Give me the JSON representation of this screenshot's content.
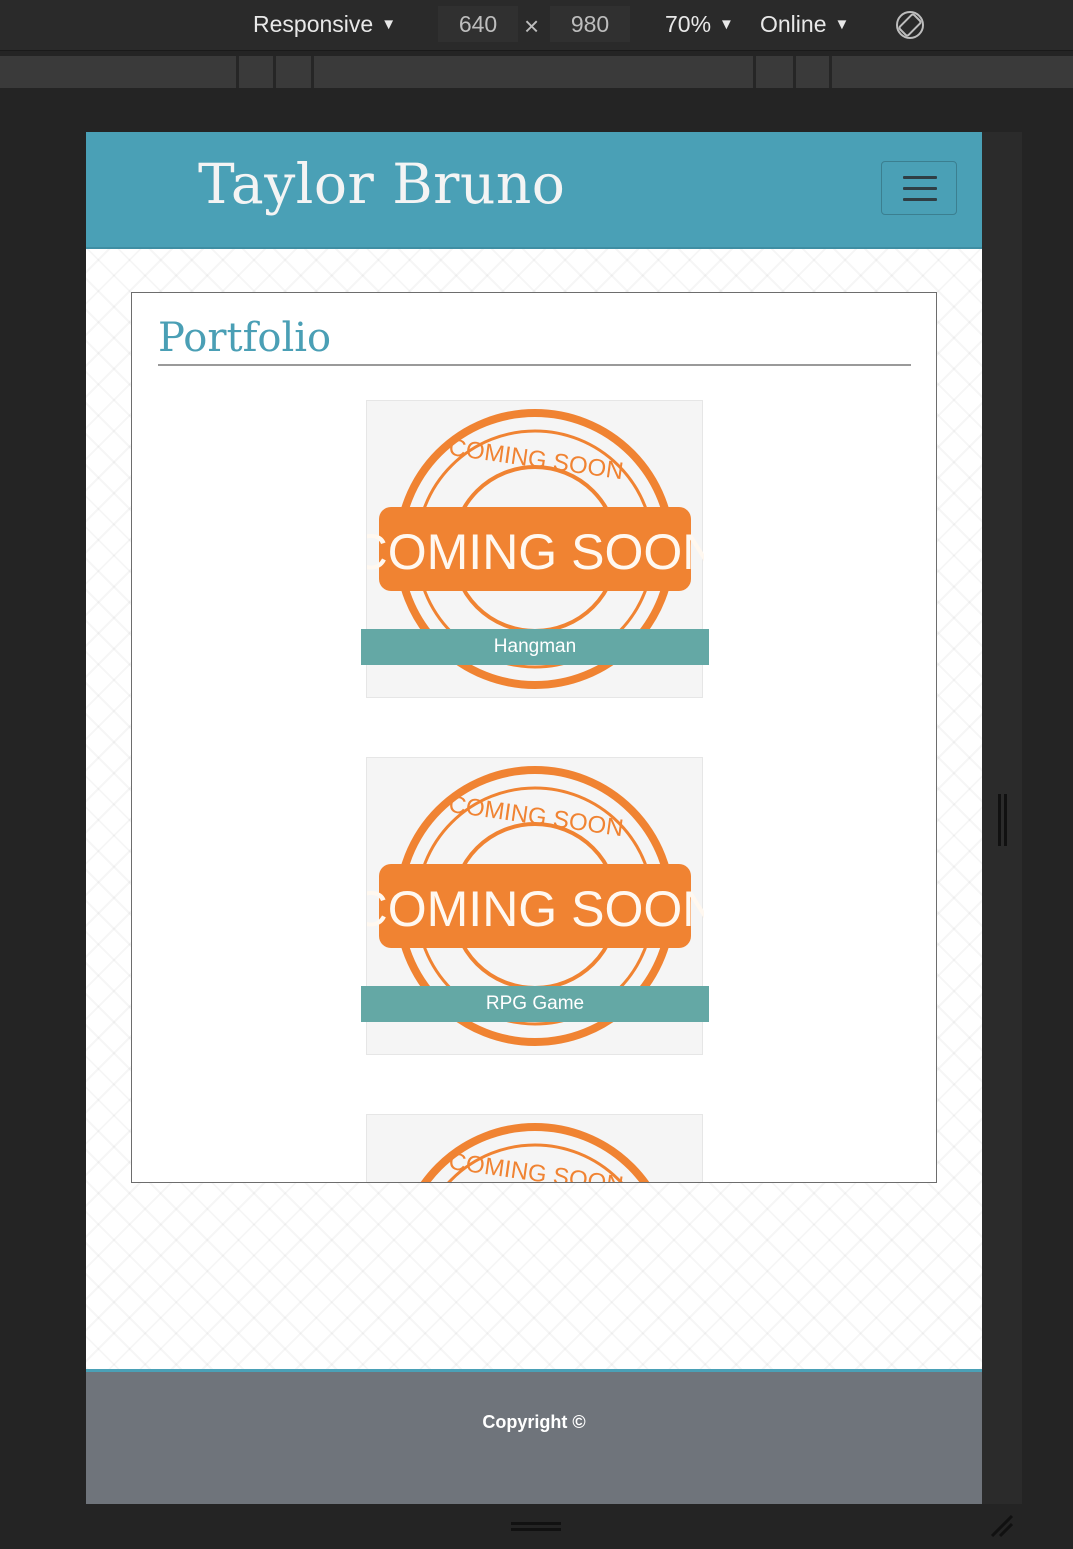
{
  "devtools": {
    "device": "Responsive",
    "width": "640",
    "times": "×",
    "height": "980",
    "zoom": "70%",
    "network": "Online",
    "icons": [
      "caret-down-icon",
      "rotate-icon",
      "resize-handle-icon"
    ]
  },
  "site": {
    "title": "Taylor Bruno",
    "accent_color": "#4aa0b6",
    "footer_color": "#6f747b",
    "label_color": "#64a8a5"
  },
  "portfolio": {
    "heading": "Portfolio",
    "badge_text_top": "COMING SOON",
    "badge_text_main": "COMING SOON",
    "badge_color": "#f08332",
    "projects": [
      {
        "label": "Hangman"
      },
      {
        "label": "RPG Game"
      },
      {
        "label": ""
      }
    ]
  },
  "footer": {
    "copyright": "Copyright ©"
  }
}
